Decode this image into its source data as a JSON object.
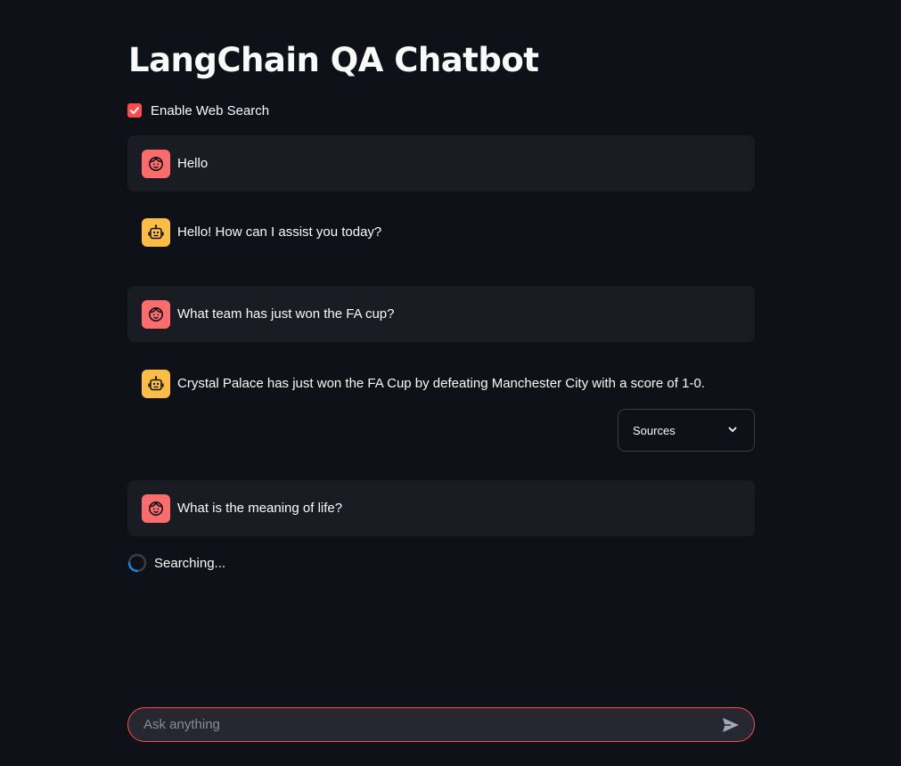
{
  "app": {
    "title": "LangChain QA Chatbot"
  },
  "web_search": {
    "label": "Enable Web Search",
    "checked": true
  },
  "messages": [
    {
      "role": "user",
      "avatar_icon": "user-face-icon",
      "text": "Hello"
    },
    {
      "role": "assistant",
      "avatar_icon": "robot-icon",
      "text": "Hello! How can I assist you today?"
    },
    {
      "role": "user",
      "avatar_icon": "user-face-icon",
      "text": "What team has just won the FA cup?"
    },
    {
      "role": "assistant",
      "avatar_icon": "robot-icon",
      "text": "Crystal Palace has just won the FA Cup by defeating Manchester City with a score of 1-0."
    },
    {
      "role": "user",
      "avatar_icon": "user-face-icon",
      "text": "What is the meaning of life?"
    }
  ],
  "sources_expander": {
    "label": "Sources",
    "icon": "chevron-down-icon"
  },
  "status": {
    "text": "Searching...",
    "icon": "spinner-icon"
  },
  "chat_input": {
    "placeholder": "Ask anything",
    "value": "",
    "send_icon": "send-icon"
  },
  "colors": {
    "background": "#0e1117",
    "user_message_bg": "#1a1c24",
    "accent": "#ff4b4b",
    "user_avatar": "#ff6c6c",
    "bot_avatar": "#ffbd45",
    "input_bg": "#262730"
  }
}
